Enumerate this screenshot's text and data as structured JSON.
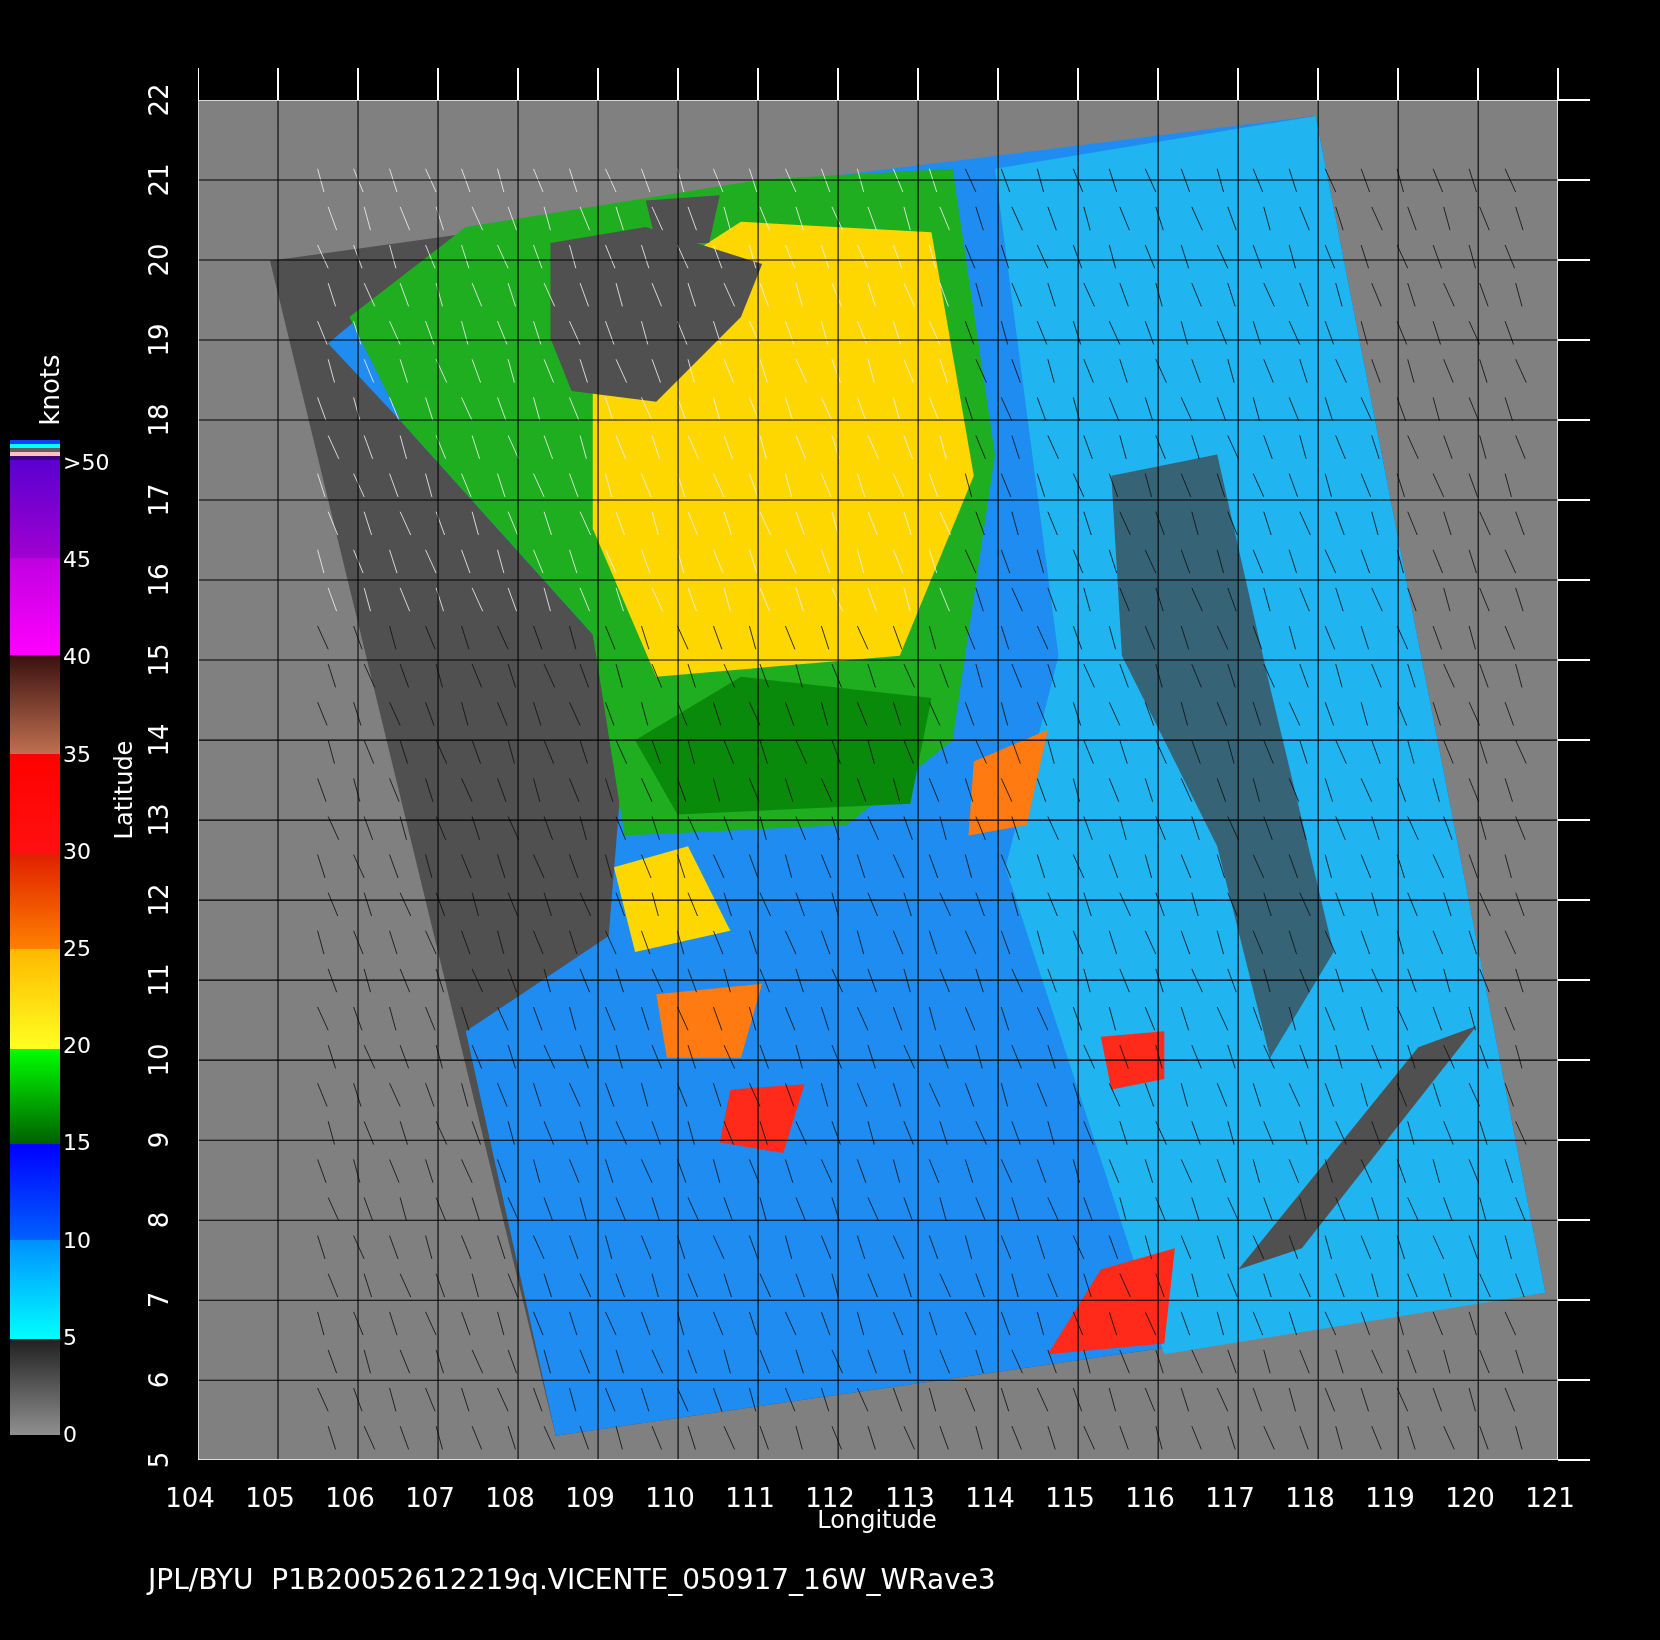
{
  "plot": {
    "xlabel": "Longitude",
    "ylabel": "Latitude",
    "xticks": [
      "104",
      "105",
      "106",
      "107",
      "108",
      "109",
      "110",
      "111",
      "112",
      "113",
      "114",
      "115",
      "116",
      "117",
      "118",
      "119",
      "120",
      "121"
    ],
    "yticks": [
      "5",
      "6",
      "7",
      "8",
      "9",
      "10",
      "11",
      "12",
      "13",
      "14",
      "15",
      "16",
      "17",
      "18",
      "19",
      "20",
      "21",
      "22"
    ]
  },
  "colorbar": {
    "unit": "knots",
    "labels": [
      ">50",
      "45",
      "40",
      "35",
      "30",
      "25",
      "20",
      "15",
      "10",
      "5",
      "0"
    ]
  },
  "footer": "JPL/BYU  P1B20052612219q.VICENTE_050917_16W_WRave3"
}
